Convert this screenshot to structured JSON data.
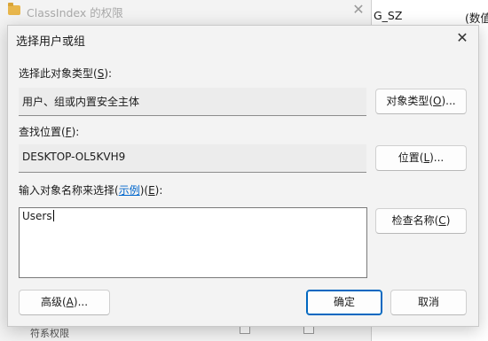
{
  "background": {
    "window_title": "ClassIndex 的权限",
    "column_text_1": "G_SZ",
    "column_text_2": "(数值",
    "bottom_text": "符系权限"
  },
  "dialog": {
    "title": "选择用户或组",
    "object_type": {
      "label_prefix": "选择此对象类型(",
      "label_key": "S",
      "label_suffix": "):",
      "value": "用户、组或内置安全主体",
      "button_prefix": "对象类型(",
      "button_key": "O",
      "button_suffix": ")..."
    },
    "location": {
      "label_prefix": "查找位置(",
      "label_key": "F",
      "label_suffix": "):",
      "value": "DESKTOP-OL5KVH9",
      "button_prefix": "位置(",
      "button_key": "L",
      "button_suffix": ")..."
    },
    "names": {
      "label_prefix": "输入对象名称来选择(",
      "link": "示例",
      "label_mid": ")(",
      "label_key": "E",
      "label_suffix": "):",
      "value": "Users",
      "check_prefix": "检查名称(",
      "check_key": "C",
      "check_suffix": ")"
    },
    "advanced_prefix": "高级(",
    "advanced_key": "A",
    "advanced_suffix": ")...",
    "ok_label": "确定",
    "cancel_label": "取消"
  }
}
